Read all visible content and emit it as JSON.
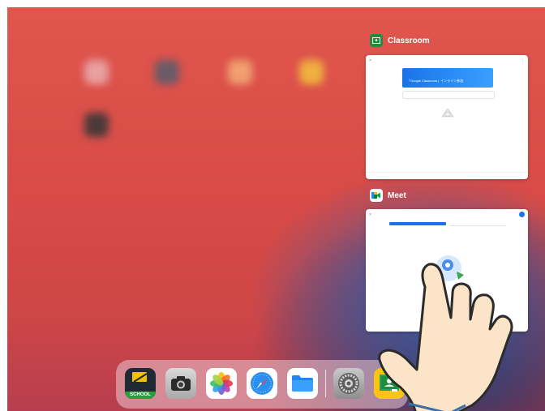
{
  "switcher": {
    "apps": [
      {
        "name": "Classroom",
        "icon": "google-classroom-icon"
      },
      {
        "name": "Meet",
        "icon": "google-meet-icon"
      }
    ]
  },
  "classroom_preview": {
    "banner_text": "「Google Classroom」インライン参加"
  },
  "dock": {
    "school_label": "SCHOOL",
    "icons": [
      "school-app-icon",
      "camera-icon",
      "photos-icon",
      "safari-icon",
      "files-icon",
      "settings-icon",
      "classroom-icon"
    ]
  },
  "colors": {
    "classroom_green": "#1e8e3e",
    "banner_blue": "#1a73e8",
    "meet_blue": "#1a73e8"
  }
}
